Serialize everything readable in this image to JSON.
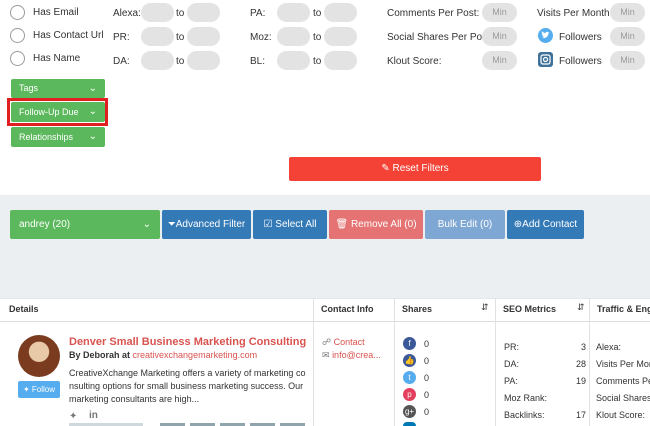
{
  "filters": {
    "checks": [
      "Has Email",
      "Has Contact Url",
      "Has Name"
    ],
    "alexa_label": "Alexa:",
    "pr_label": "PR:",
    "da_label": "DA:",
    "pa_label": "PA:",
    "moz_label": "Moz:",
    "bl_label": "BL:",
    "to": "to",
    "comments_label": "Comments Per Post:",
    "shares_label": "Social Shares Per Post:",
    "klout_label": "Klout Score:",
    "visits_label": "Visits Per Month:",
    "followers_label": "Followers",
    "min": "Min"
  },
  "dropdowns": {
    "tags": "Tags",
    "followup": "Follow-Up Due",
    "relationships": "Relationships"
  },
  "reset_label": "Reset Filters",
  "toolbar": {
    "list": "andrey (20)",
    "advanced": "Advanced Filter",
    "select_all": "Select All",
    "remove_all": "Remove All (0)",
    "bulk_edit": "Bulk Edit (0)",
    "add_contact": "Add Contact"
  },
  "table": {
    "headers": [
      "Details",
      "Contact Info",
      "Shares",
      "SEO Metrics",
      "Traffic & Eng"
    ],
    "row": {
      "title": "Denver Small Business Marketing Consulting",
      "by": "By Deborah at",
      "domain": "creativexchangemarketing.com",
      "desc_lines": [
        "CreativeXchange Marketing offers a variety of marketing co",
        "nsulting options for small business marketing success. Our",
        "marketing consultants are high..."
      ],
      "follow": "Follow",
      "contact": "Contact",
      "email": "info@crea...",
      "shares": [
        "0",
        "0",
        "0",
        "0",
        "0"
      ],
      "seo": [
        {
          "k": "PR:",
          "v": "3"
        },
        {
          "k": "DA:",
          "v": "28"
        },
        {
          "k": "PA:",
          "v": "19"
        },
        {
          "k": "Moz Rank:",
          "v": ""
        },
        {
          "k": "Backlinks:",
          "v": "17"
        }
      ],
      "traffic": [
        "Alexa:",
        "Visits Per Mon",
        "Comments Pe",
        "Social Shares",
        "Klout Score:"
      ]
    }
  },
  "colors": {
    "green": "#5cb85c",
    "blue": "#337ab7",
    "red": "#f44336",
    "pink": "#e57373",
    "light_blue": "#7fa7d4",
    "highlight": "#e02020"
  }
}
